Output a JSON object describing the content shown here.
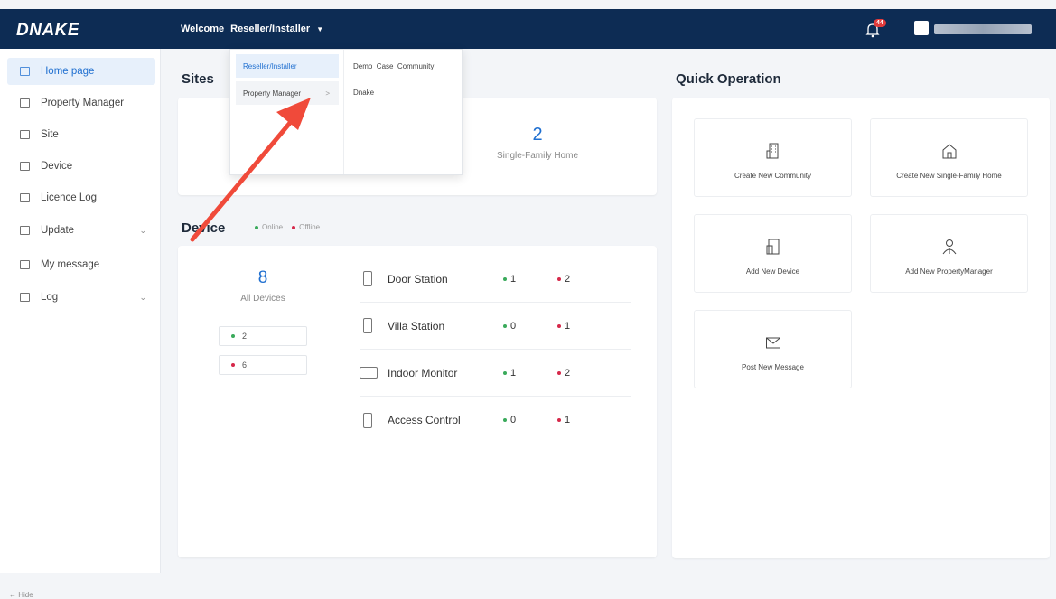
{
  "header": {
    "logo": "DNAKE",
    "welcome": "Welcome",
    "role": "Reseller/Installer",
    "notification_count": "44",
    "colors": {
      "bar": "#0d2c54",
      "accent": "#1f6fd0",
      "badge": "#e23b3b"
    }
  },
  "sidebar": {
    "items": [
      {
        "label": "Home page",
        "icon": "home-icon",
        "active": true
      },
      {
        "label": "Property Manager",
        "icon": "building-icon"
      },
      {
        "label": "Site",
        "icon": "site-icon"
      },
      {
        "label": "Device",
        "icon": "device-icon"
      },
      {
        "label": "Licence Log",
        "icon": "licence-icon"
      },
      {
        "label": "Update",
        "icon": "update-icon",
        "expandable": true
      },
      {
        "label": "My message",
        "icon": "mail-icon"
      },
      {
        "label": "Log",
        "icon": "log-icon",
        "expandable": true
      }
    ],
    "hide_label": "Hide"
  },
  "sites": {
    "title": "Sites",
    "single_family_count": "2",
    "single_family_label": "Single-Family Home"
  },
  "device": {
    "title": "Device",
    "legend_online": "Online",
    "legend_offline": "Offline",
    "total": "8",
    "total_label": "All Devices",
    "online_total": "2",
    "offline_total": "6",
    "rows": [
      {
        "name": "Door Station",
        "online": "1",
        "offline": "2",
        "icon": "door-station-icon"
      },
      {
        "name": "Villa Station",
        "online": "0",
        "offline": "1",
        "icon": "villa-station-icon"
      },
      {
        "name": "Indoor Monitor",
        "online": "1",
        "offline": "2",
        "icon": "indoor-monitor-icon"
      },
      {
        "name": "Access Control",
        "online": "0",
        "offline": "1",
        "icon": "access-control-icon"
      }
    ]
  },
  "quick_operation": {
    "title": "Quick Operation",
    "cards": [
      {
        "label": "Create New Community",
        "icon": "community-icon"
      },
      {
        "label": "Create New Single-Family Home",
        "icon": "house-icon"
      },
      {
        "label": "Add New Device",
        "icon": "add-device-icon"
      },
      {
        "label": "Add New PropertyManager",
        "icon": "person-icon"
      },
      {
        "label": "Post New Message",
        "icon": "envelope-icon"
      }
    ]
  },
  "role_dropdown": {
    "roles": [
      "Reseller/Installer",
      "Property Manager"
    ],
    "sub_items": [
      "Demo_Case_Community",
      "Dnake"
    ]
  }
}
